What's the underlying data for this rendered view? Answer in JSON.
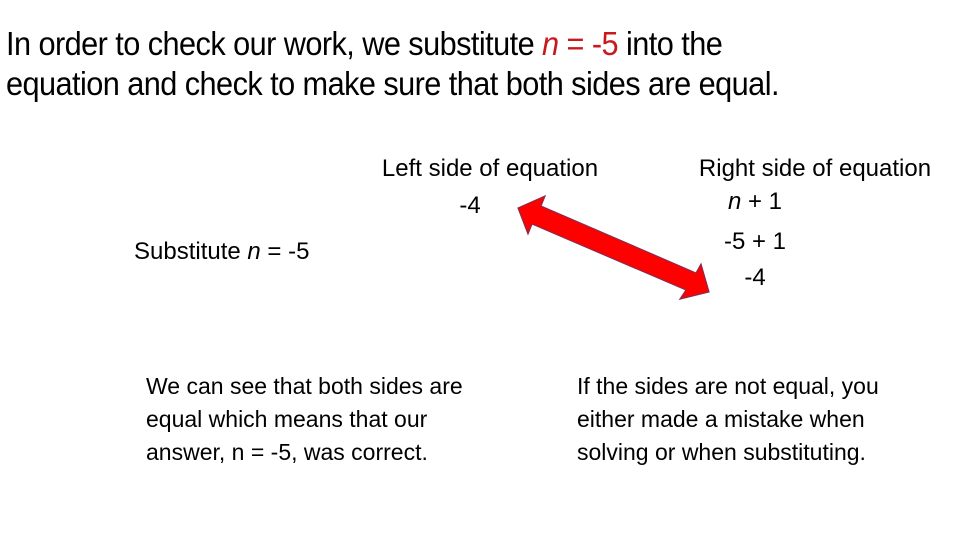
{
  "title": {
    "before": "In order to check our work, we substitute ",
    "var": "n",
    "highlight_rest": " = -5",
    "after_line1": " into the",
    "line2": "equation and check to make sure that both sides are equal."
  },
  "substitute": {
    "label": "Substitute ",
    "var": "n",
    "rest": " = -5"
  },
  "left_side": {
    "heading": "Left side of equation",
    "value": "-4"
  },
  "right_side": {
    "heading": "Right side of equation",
    "expr_var": "n",
    "expr_rest": " + 1",
    "step2": "-5 + 1",
    "result": "-4"
  },
  "conclusion_left": {
    "lines": [
      "We can see that both sides are",
      "equal which means that our",
      "answer, n = -5, was correct."
    ]
  },
  "conclusion_right": {
    "lines": [
      "If the sides are not equal, you",
      "either made a mistake when",
      "solving or when substituting."
    ]
  },
  "colors": {
    "highlight": "#c8191e",
    "arrow_fill": "#ff0000",
    "arrow_stroke": "#8b2a4a"
  }
}
